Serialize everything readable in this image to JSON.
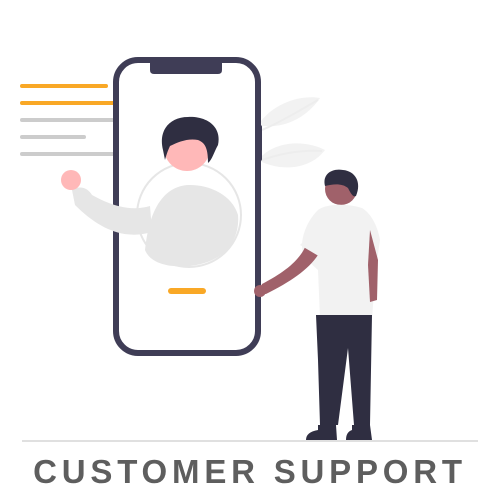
{
  "title": "CUSTOMER SUPPORT",
  "colors": {
    "accent": "#f9a826",
    "dark": "#3f3d56",
    "skin": "#ffb8b8",
    "hair": "#2f2e41",
    "light_gray": "#e6e6e6",
    "line_gray": "#cccccc",
    "text": "#5e5e5e"
  }
}
